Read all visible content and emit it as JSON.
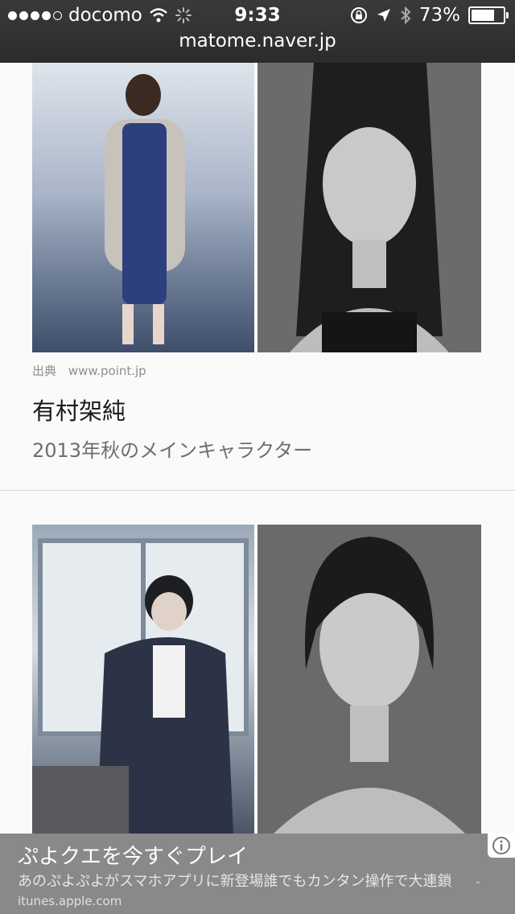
{
  "status_bar": {
    "carrier": "docomo",
    "time": "9:33",
    "battery": "73%",
    "battery_level": 0.73,
    "signal_bars": 4,
    "icons": [
      "wifi-icon",
      "loading-spinner-icon",
      "rotation-lock-icon",
      "location-arrow-icon",
      "bluetooth-icon",
      "battery-icon"
    ]
  },
  "browser": {
    "url": "matome.naver.jp"
  },
  "entries": [
    {
      "source_label": "出典",
      "source_url": "www.point.jp",
      "name": "有村架純",
      "description": "2013年秋のメインキャラクター"
    }
  ],
  "ad": {
    "title": "ぷよクエを今すぐプレイ",
    "body": "あのぷよぷよがスマホアプリに新登場誰でもカンタン操作で大連鎖",
    "source": "- itunes.apple.com",
    "info_icon": "info-icon"
  }
}
